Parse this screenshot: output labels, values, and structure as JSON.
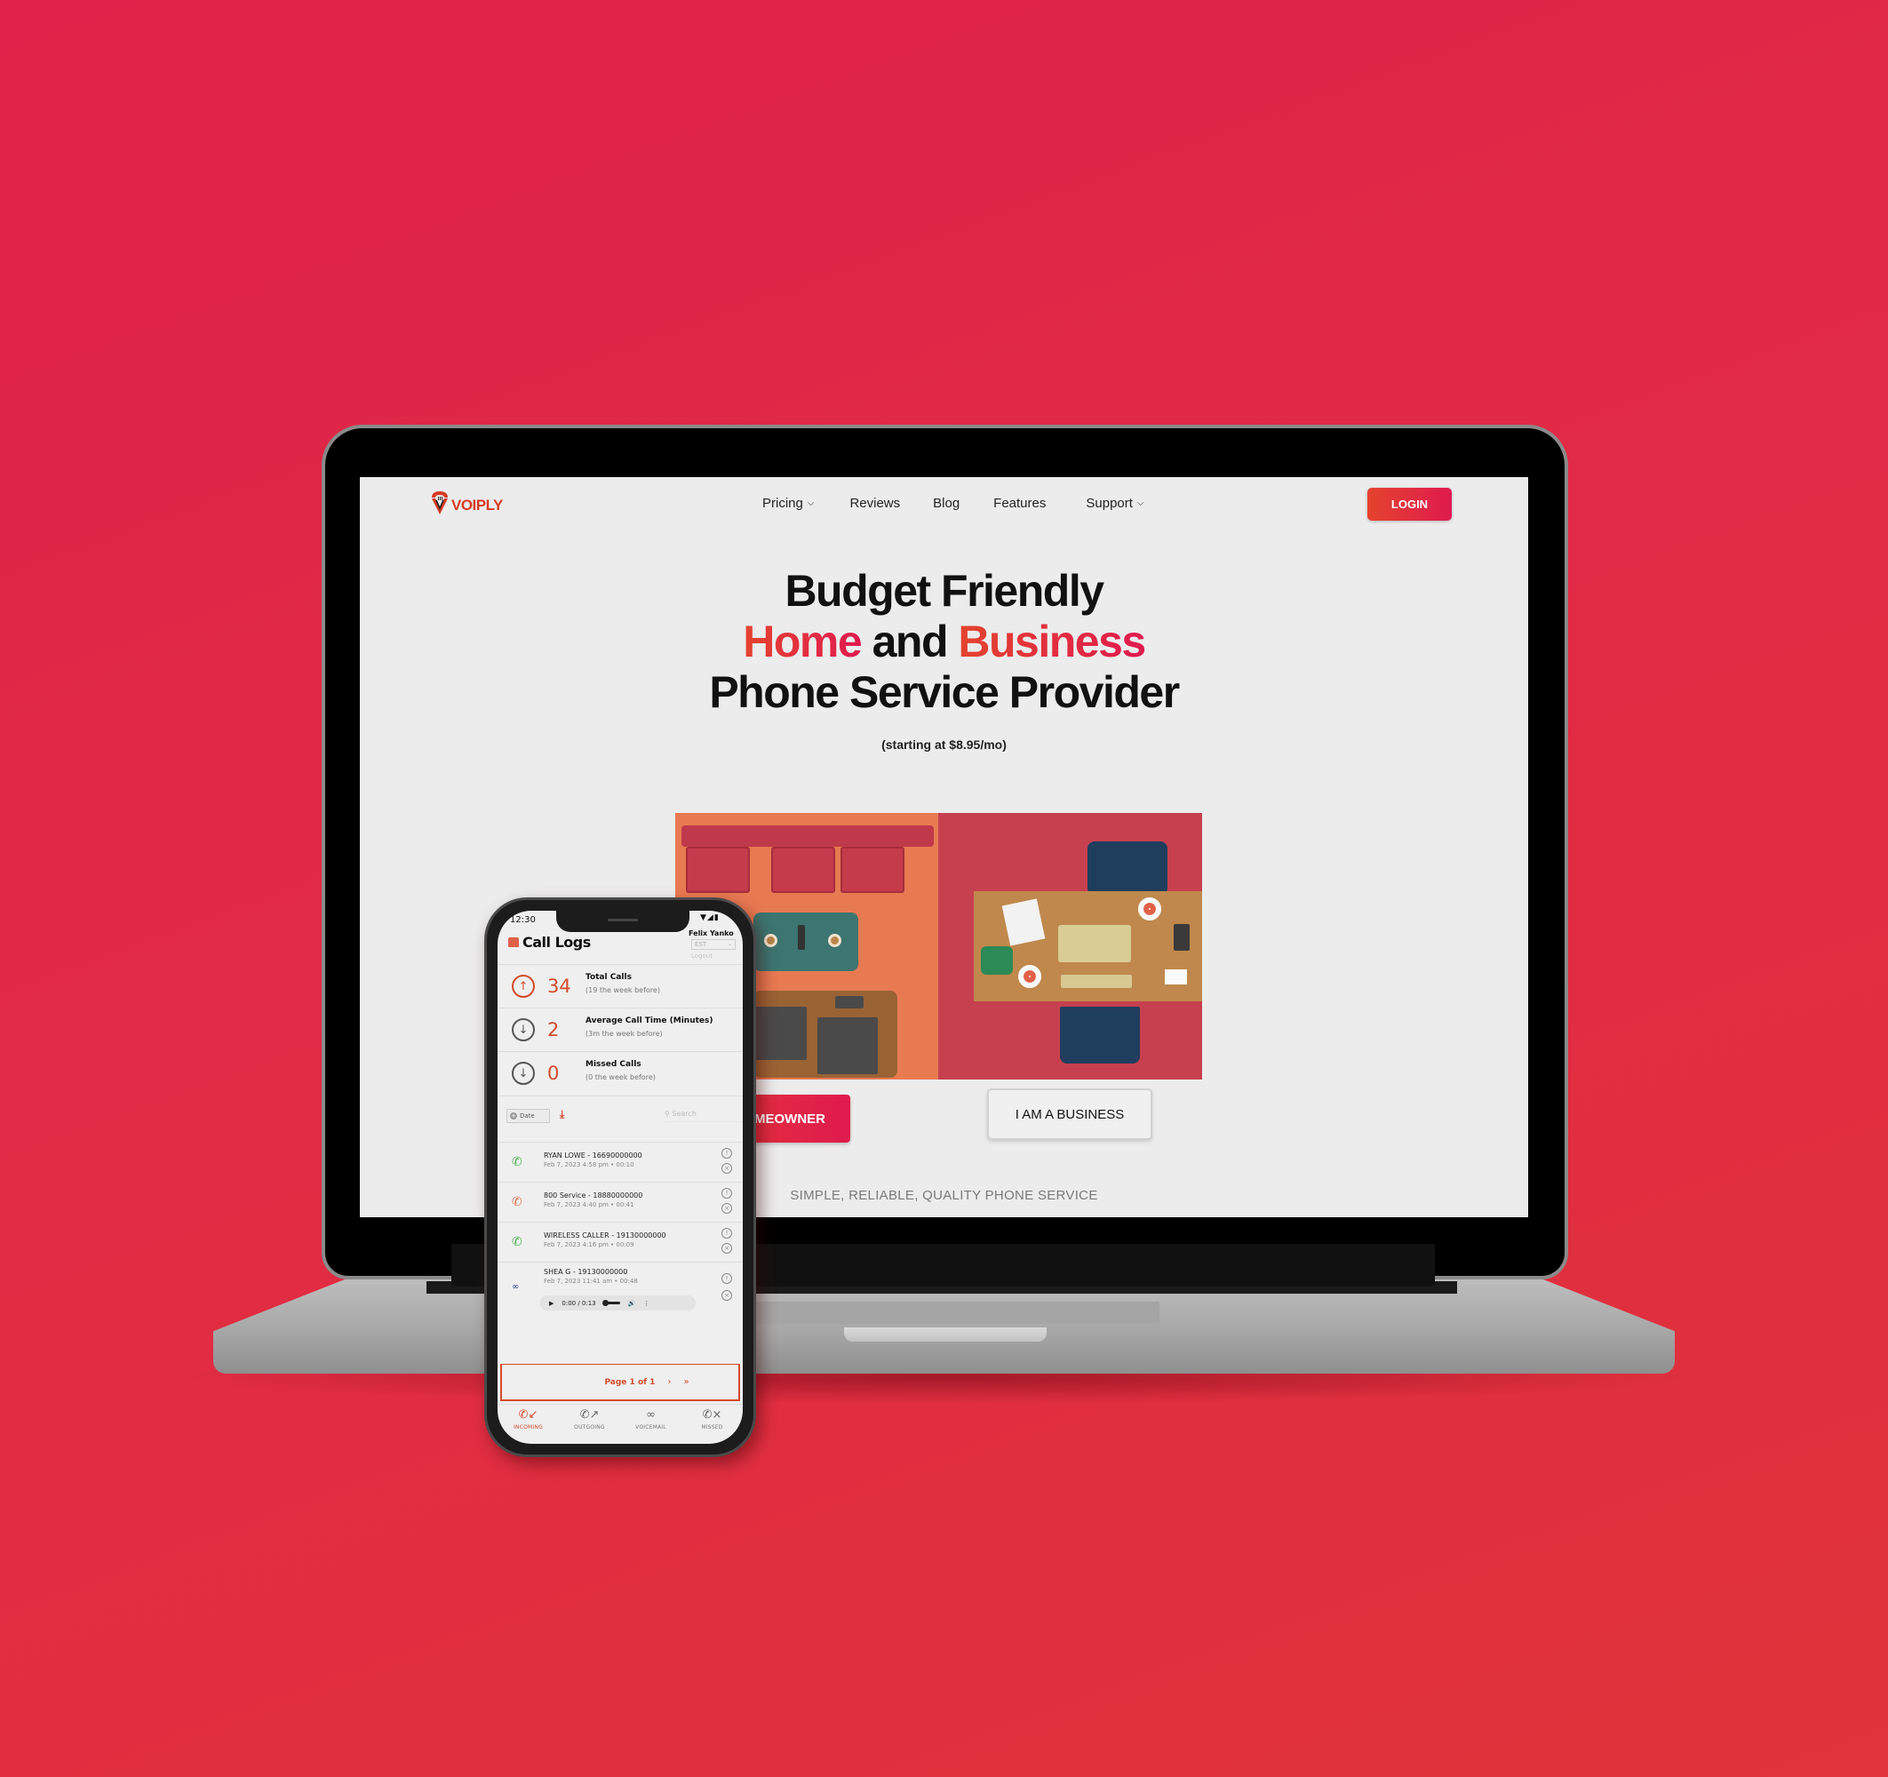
{
  "website": {
    "brand": "VOIPLY",
    "nav": {
      "items": [
        {
          "label": "Pricing",
          "has_dropdown": true
        },
        {
          "label": "Reviews",
          "has_dropdown": false
        },
        {
          "label": "Blog",
          "has_dropdown": false
        },
        {
          "label": "Features",
          "has_dropdown": false
        },
        {
          "label": "Support",
          "has_dropdown": true
        }
      ],
      "login_label": "LOGIN"
    },
    "hero": {
      "line1": "Budget Friendly",
      "line2_accent_a": "Home",
      "line2_mid": " and ",
      "line2_accent_b": "Business",
      "line3": "Phone Service Provider",
      "subtitle": "(starting at $8.95/mo)",
      "image_alt": "Illustration of living room and office desk, top view"
    },
    "cta": {
      "homeowner_label": "I AM A HOMEOWNER",
      "homeowner_visible_label": "M A HOMEOWNER",
      "business_label": "I AM A BUSINESS"
    },
    "tagline": "SIMPLE, RELIABLE, QUALITY PHONE SERVICE",
    "colors": {
      "accent_start": "#e4432e",
      "accent_end": "#e01a4f",
      "page_bg": "#ececec"
    }
  },
  "phone_app": {
    "status_bar": {
      "time": "12:30",
      "icons": "wifi-signal-battery"
    },
    "title": "Call Logs",
    "user": {
      "name": "Felix Yanko",
      "timezone": "EST",
      "logout_label": "Logout"
    },
    "stats": [
      {
        "icon": "arrow-up-circle-icon",
        "value": "34",
        "label": "Total Calls",
        "sub": "(19 the week before)"
      },
      {
        "icon": "arrow-down-circle-icon",
        "value": "2",
        "label": "Average Call Time (Minutes)",
        "sub": "(3m the week before)"
      },
      {
        "icon": "arrow-down-circle-icon",
        "value": "0",
        "label": "Missed Calls",
        "sub": "(0 the week before)"
      }
    ],
    "filters": {
      "date_label": "Date",
      "search_placeholder": "Search"
    },
    "calls": [
      {
        "type": "incoming",
        "name": "RYAN LOWE - 16690000000",
        "date": "Feb 7, 2023 4:58 pm",
        "duration": "00:10"
      },
      {
        "type": "missed",
        "name": "800 Service - 18880000000",
        "date": "Feb 7, 2023 4:40 pm",
        "duration": "00:41"
      },
      {
        "type": "incoming",
        "name": "WIRELESS CALLER - 19130000000",
        "date": "Feb 7, 2023 4:16 pm",
        "duration": "00:09"
      },
      {
        "type": "voicemail",
        "name": "SHEA G - 19130000000",
        "date": "Feb 7, 2023 11:41 am",
        "duration": "00:48",
        "player": {
          "time": "0:00 / 0:13"
        }
      }
    ],
    "pagination": {
      "label": "Page 1 of 1",
      "next": "›",
      "last": "»"
    },
    "tabs": [
      {
        "label": "INCOMING",
        "icon": "phone-incoming-icon",
        "active": true
      },
      {
        "label": "OUTGOING",
        "icon": "phone-outgoing-icon",
        "active": false
      },
      {
        "label": "VOICEMAIL",
        "icon": "voicemail-icon",
        "active": false
      },
      {
        "label": "MISSED",
        "icon": "phone-missed-icon",
        "active": false
      }
    ],
    "colors": {
      "accent": "#d44a2c",
      "incoming": "#4caf50",
      "missed": "#e07050",
      "voicemail": "#3a4aa8"
    }
  }
}
